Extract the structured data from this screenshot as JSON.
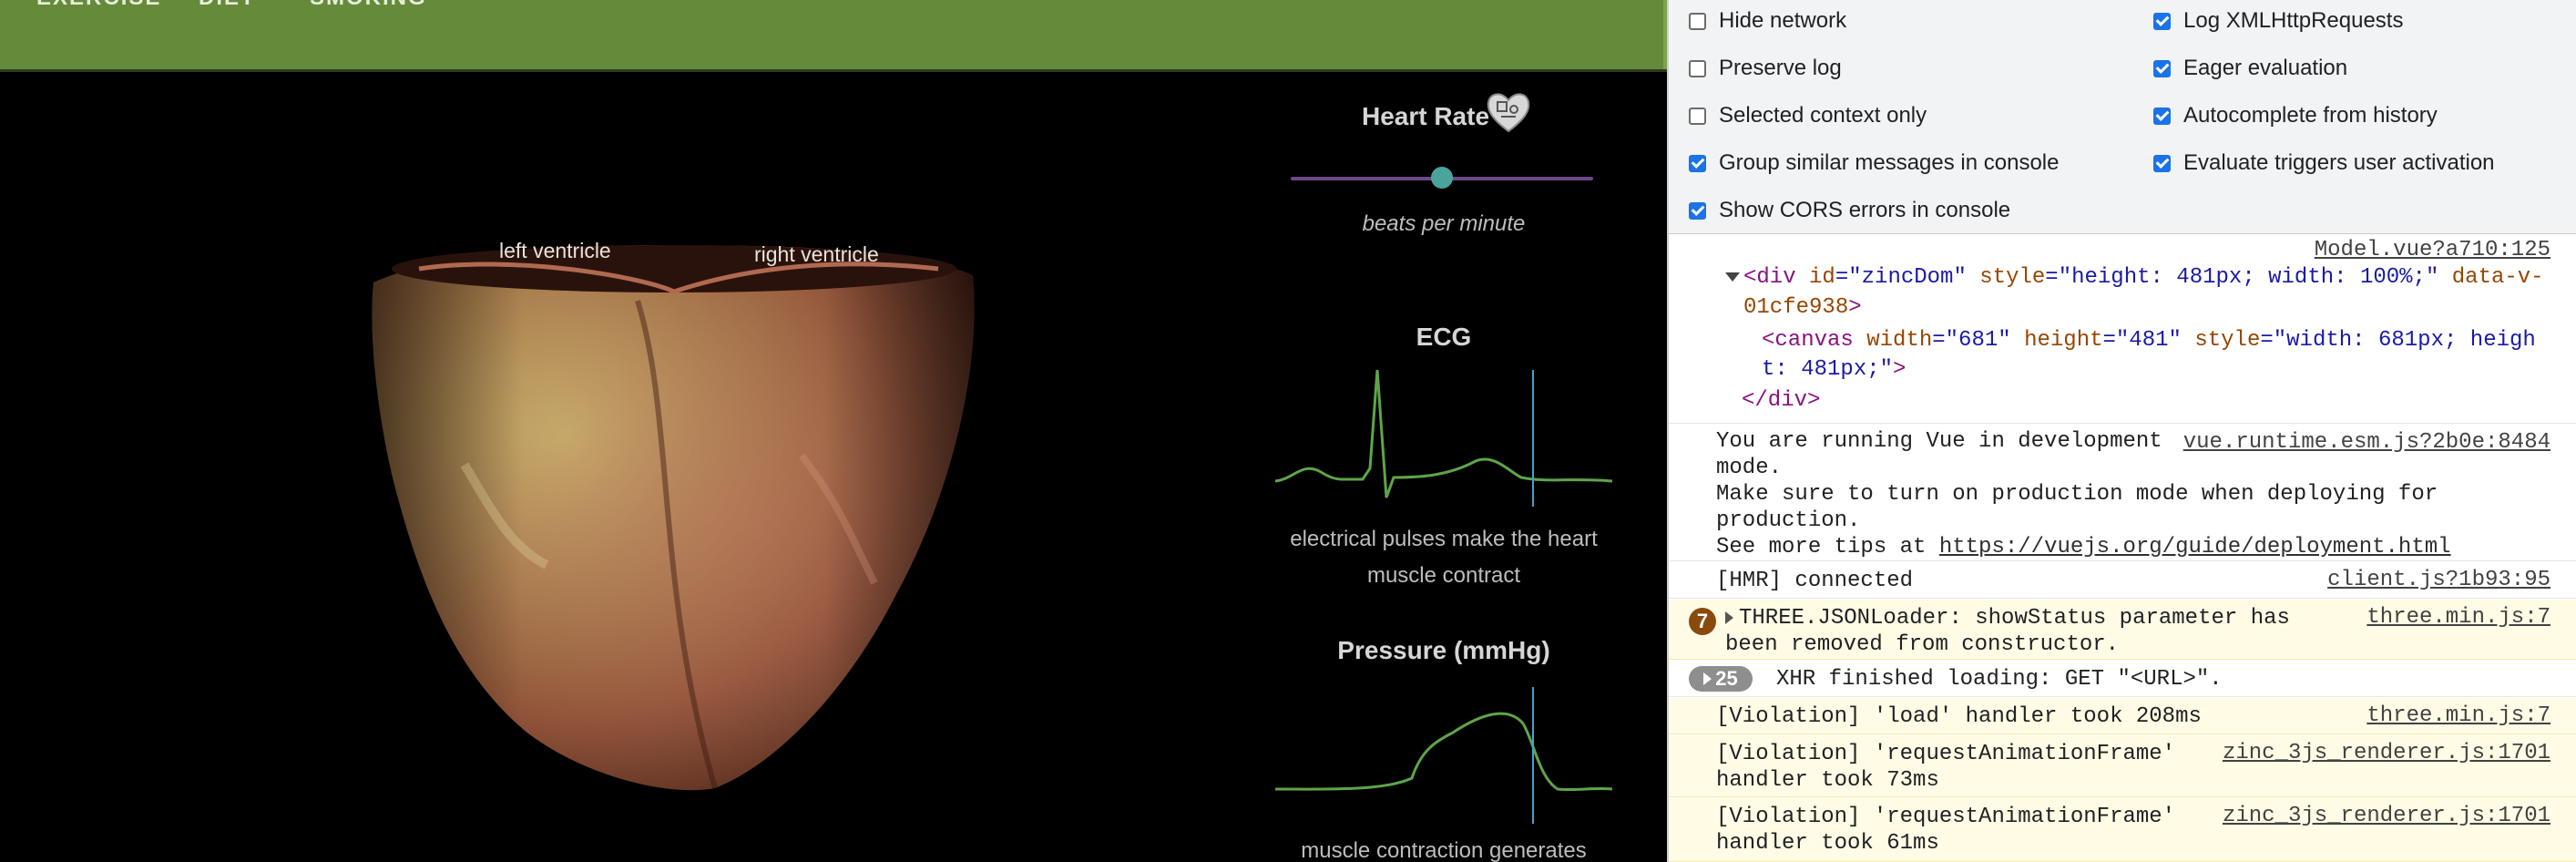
{
  "nav": {
    "tabs": [
      "EXERCISE",
      "DIET",
      "SMOKING"
    ]
  },
  "heart": {
    "labels": {
      "left": "left ventricle",
      "right": "right ventricle"
    }
  },
  "panels": {
    "heart_rate": {
      "title": "Heart Rate",
      "unit_label": "beats per minute",
      "slider_fraction": 0.5
    },
    "ecg": {
      "title": "ECG",
      "caption_line1": "electrical pulses make the heart",
      "caption_line2": "muscle contract"
    },
    "pressure": {
      "title": "Pressure (mmHg)",
      "caption": "muscle contraction generates"
    }
  },
  "devtools": {
    "settings": {
      "left": [
        {
          "label": "Hide network",
          "checked": false
        },
        {
          "label": "Preserve log",
          "checked": false
        },
        {
          "label": "Selected context only",
          "checked": false
        },
        {
          "label": "Group similar messages in console",
          "checked": true
        },
        {
          "label": "Show CORS errors in console",
          "checked": true
        }
      ],
      "right": [
        {
          "label": "Log XMLHttpRequests",
          "checked": true
        },
        {
          "label": "Eager evaluation",
          "checked": true
        },
        {
          "label": "Autocomplete from history",
          "checked": true
        },
        {
          "label": "Evaluate triggers user activation",
          "checked": true
        }
      ]
    },
    "console": {
      "element_log": {
        "source": "Model.vue?a710:125",
        "div_open": "<div",
        "div_id_attr": "id",
        "div_id_val": "\"zincDom\"",
        "div_style_attr": "style",
        "div_style_val": "\"height: 481px; width: 100%;\"",
        "div_data_attr": "data-v-",
        "div_data_attr2": "01cfe938",
        "div_gt": ">",
        "canvas_open": "<canvas",
        "canvas_width_attr": "width",
        "canvas_width_val": "\"681\"",
        "canvas_height_attr": "height",
        "canvas_height_val": "\"481\"",
        "canvas_style_attr": "style",
        "canvas_style_val1": "\"width: 681px; heigh",
        "canvas_style_val2": "t: 481px;\"",
        "canvas_gt": ">",
        "div_close": "</div>",
        "eq": "="
      },
      "vue_dev": {
        "line1": "You are running Vue in development",
        "line2": "mode.",
        "line3": "Make sure to turn on production mode when deploying for",
        "line4": "production.",
        "line5_prefix": "See more tips at ",
        "line5_link": "https://vuejs.org/guide/deployment.html",
        "source": "vue.runtime.esm.js?2b0e:8484"
      },
      "hmr": {
        "text": "[HMR] connected",
        "source": "client.js?1b93:95"
      },
      "three_warn": {
        "count": "7",
        "line1": "THREE.JSONLoader: showStatus parameter has",
        "line2": "been removed from constructor.",
        "source": "three.min.js:7"
      },
      "xhr_group": {
        "count": "25",
        "text": "XHR finished loading: GET \"<URL>\"."
      },
      "violations": [
        {
          "line1": "[Violation] 'load' handler took 208ms",
          "line2": "",
          "source": "three.min.js:7"
        },
        {
          "line1": "[Violation] 'requestAnimationFrame'",
          "line2": "handler took 73ms",
          "source": "zinc_3js_renderer.js:1701"
        },
        {
          "line1": "[Violation] 'requestAnimationFrame'",
          "line2": "handler took 61ms",
          "source": "zinc_3js_renderer.js:1701"
        }
      ]
    }
  }
}
